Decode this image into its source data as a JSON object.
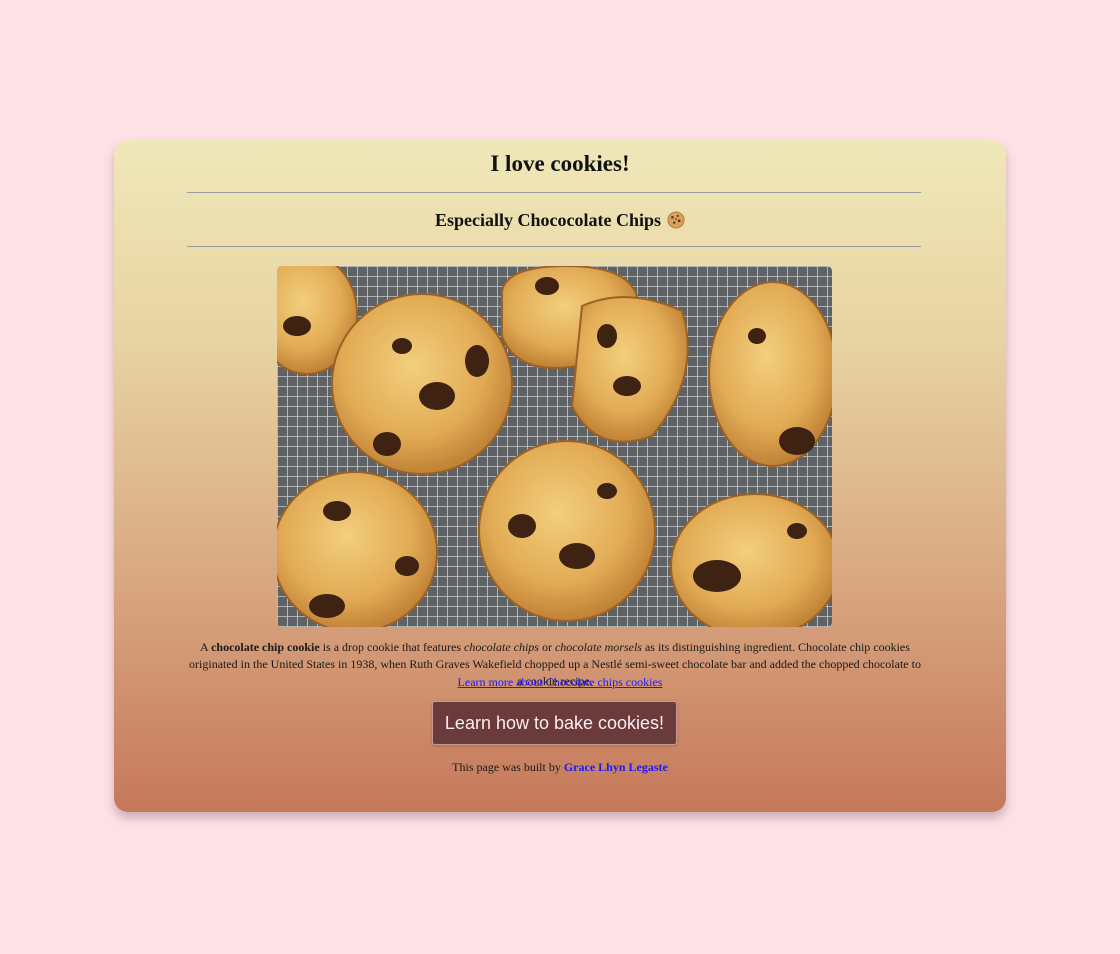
{
  "header": {
    "title": "I love cookies!",
    "subtitle": "Especially Chococolate Chips"
  },
  "image": {
    "icon": "cookies-on-rack-photo"
  },
  "description": {
    "prefix": "A ",
    "term": "chocolate chip cookie",
    "mid1": " is a drop cookie that features ",
    "em1": "chocolate chips",
    "mid2": " or ",
    "em2": "chocolate morsels",
    "rest": " as its distinguishing ingredient. Chocolate chip cookies originated in the United States in 1938, when Ruth Graves Wakefield chopped up a Nestlé semi-sweet chocolate bar and added the chopped chocolate to a cookie recipe."
  },
  "links": {
    "learn_more": "Learn more about Chocolate chips cookies"
  },
  "button": {
    "label": "Learn how to bake cookies!"
  },
  "footer": {
    "credit_prefix": "This page was built by ",
    "author": "Grace Lhyn Legaste"
  },
  "colors": {
    "background": "#fee1e7",
    "button_bg": "#6b3a3a",
    "link": "#1a1aff"
  }
}
